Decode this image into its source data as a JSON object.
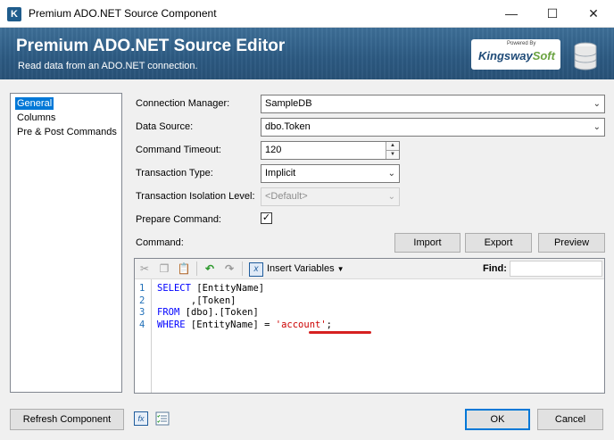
{
  "window": {
    "title": "Premium ADO.NET Source Component",
    "app_icon_letter": "K",
    "minimize_glyph": "—",
    "maximize_glyph": "☐",
    "close_glyph": "✕"
  },
  "banner": {
    "title": "Premium ADO.NET Source Editor",
    "subtitle": "Read data from an ADO.NET connection.",
    "logo_powered_by": "Powered By",
    "logo_brand": "Kingsway",
    "logo_brand_suffix": "Soft"
  },
  "nav": {
    "items": [
      {
        "label": "General",
        "selected": true
      },
      {
        "label": "Columns",
        "selected": false
      },
      {
        "label": "Pre & Post Commands",
        "selected": false
      }
    ]
  },
  "form": {
    "connection_manager": {
      "label": "Connection Manager:",
      "value": "SampleDB"
    },
    "data_source": {
      "label": "Data Source:",
      "value": "dbo.Token"
    },
    "command_timeout": {
      "label": "Command Timeout:",
      "value": "120"
    },
    "transaction_type": {
      "label": "Transaction Type:",
      "value": "Implicit"
    },
    "isolation_level": {
      "label": "Transaction Isolation Level:",
      "value": "<Default>",
      "enabled": false
    },
    "prepare_command": {
      "label": "Prepare Command:",
      "checked": true,
      "check_glyph": "✓"
    },
    "command": {
      "label": "Command:"
    }
  },
  "command_buttons": {
    "import": "Import",
    "export": "Export",
    "preview": "Preview"
  },
  "editor": {
    "insert_variables": "Insert Variables",
    "find_label": "Find:",
    "find_value": "",
    "lines": [
      {
        "num": "1",
        "parts": [
          {
            "t": "SELECT",
            "c": "kw"
          },
          {
            "t": " [EntityName]",
            "c": ""
          }
        ]
      },
      {
        "num": "2",
        "parts": [
          {
            "t": "      ,[Token]",
            "c": ""
          }
        ]
      },
      {
        "num": "3",
        "parts": [
          {
            "t": "FROM",
            "c": "kw"
          },
          {
            "t": " [dbo].[Token]",
            "c": ""
          }
        ]
      },
      {
        "num": "4",
        "parts": [
          {
            "t": "WHERE",
            "c": "kw"
          },
          {
            "t": " [EntityName] = ",
            "c": ""
          },
          {
            "t": "'account'",
            "c": "str"
          },
          {
            "t": ";",
            "c": ""
          }
        ]
      }
    ]
  },
  "footer": {
    "refresh": "Refresh Component",
    "ok": "OK",
    "cancel": "Cancel"
  },
  "icons": {
    "cut": "cut-icon",
    "copy": "copy-icon",
    "paste": "paste-icon",
    "undo": "undo-icon",
    "redo": "redo-icon",
    "variables": "variables-icon",
    "expression": "expression-icon",
    "checklist": "checklist-icon",
    "database": "database-icon"
  },
  "colors": {
    "banner": "#2c5a82",
    "selection": "#0078d7",
    "keyword": "#0000ff",
    "string": "#cc0000"
  }
}
